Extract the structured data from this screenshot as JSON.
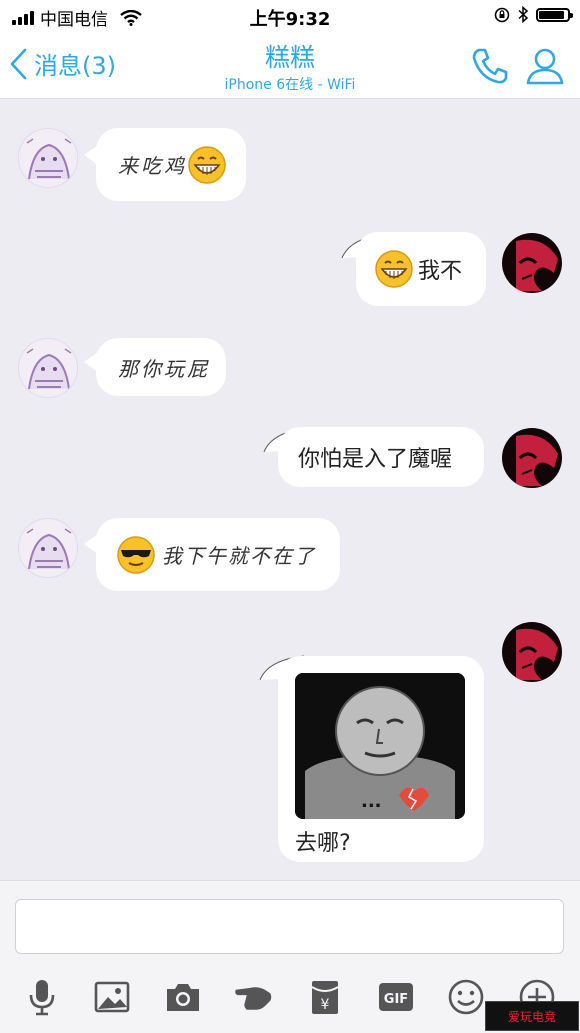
{
  "status_bar": {
    "carrier": "中国电信",
    "time": "上午9:32",
    "battery_level": 0.9
  },
  "nav": {
    "back_label": "消息(3)",
    "title": "糕糕",
    "subtitle": "iPhone 6在线 - WiFi"
  },
  "messages": [
    {
      "side": "left",
      "text": "来吃鸡",
      "emoji": "grin-emoji"
    },
    {
      "side": "right",
      "text": "我不",
      "emoji": "grin-emoji"
    },
    {
      "side": "left",
      "text": "那你玩屁"
    },
    {
      "side": "right",
      "text": "你怕是入了魔喔"
    },
    {
      "side": "left",
      "text": "我下午就不在了",
      "emoji": "sunglasses-emoji"
    },
    {
      "side": "right",
      "text": "去哪?",
      "image": "meme-face-image",
      "image_caption": "..."
    }
  ],
  "input": {
    "placeholder": "",
    "toolbar": [
      "microphone-icon",
      "image-icon",
      "camera-icon",
      "poke-icon",
      "red-packet-icon",
      "gif-icon",
      "emoji-icon",
      "plus-icon"
    ],
    "gif_label": "GIF",
    "red_packet_glyph": "¥"
  },
  "watermark": "爱玩电竞",
  "colors": {
    "accent": "#2fa8e0",
    "chat_background": "#ececf2",
    "bubble": "#ffffff"
  }
}
